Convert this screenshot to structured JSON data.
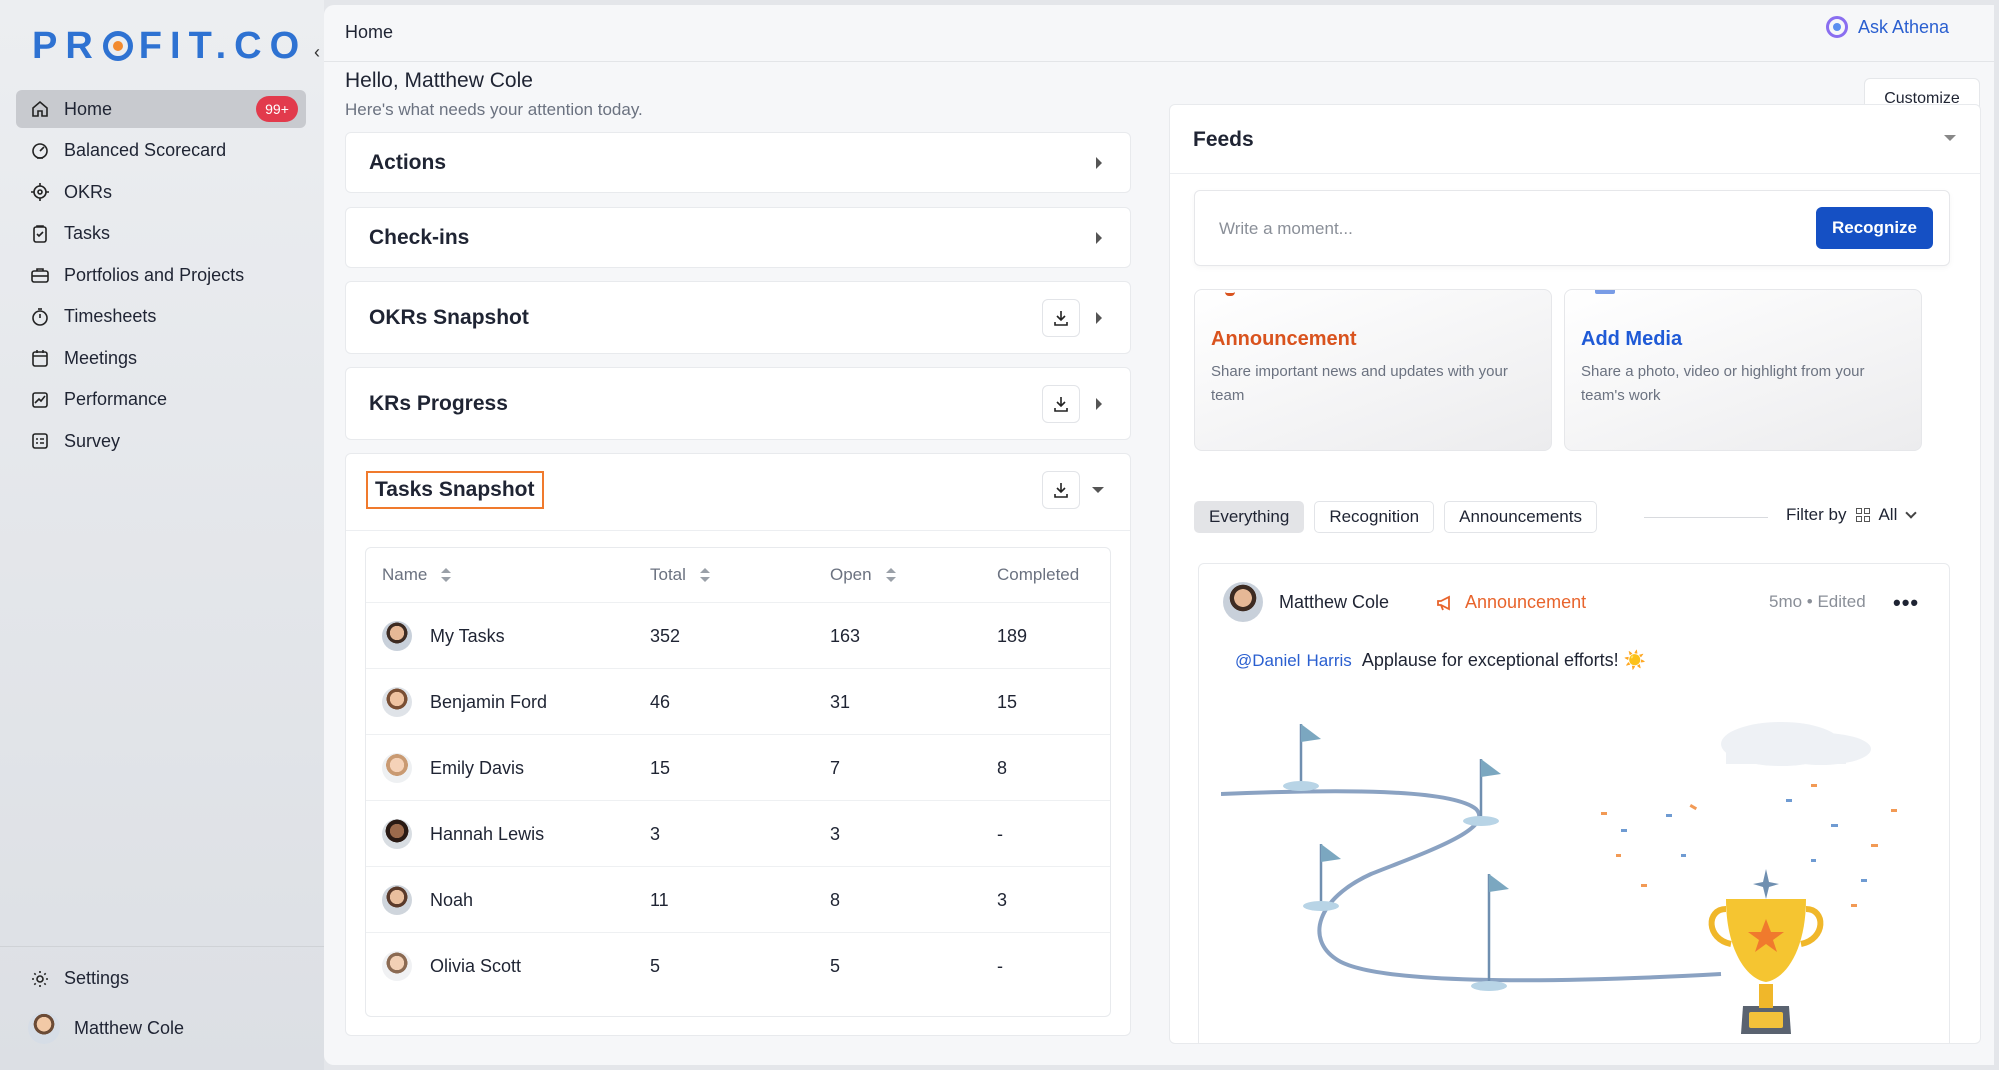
{
  "brand": {
    "logo_left": "PR",
    "logo_right": "FIT.CO"
  },
  "sidebar": {
    "items": [
      {
        "label": "Home",
        "icon": "home-icon",
        "badge": "99+"
      },
      {
        "label": "Balanced Scorecard",
        "icon": "scorecard-icon"
      },
      {
        "label": "OKRs",
        "icon": "target-icon"
      },
      {
        "label": "Tasks",
        "icon": "clipboard-icon"
      },
      {
        "label": "Portfolios and Projects",
        "icon": "briefcase-icon"
      },
      {
        "label": "Timesheets",
        "icon": "stopwatch-icon"
      },
      {
        "label": "Meetings",
        "icon": "calendar-icon"
      },
      {
        "label": "Performance",
        "icon": "chart-icon"
      },
      {
        "label": "Survey",
        "icon": "checklist-icon"
      }
    ],
    "settings_label": "Settings",
    "user_name": "Matthew Cole"
  },
  "header": {
    "breadcrumb": "Home",
    "ask_label": "Ask Athena"
  },
  "greeting": {
    "title": "Hello, Matthew Cole",
    "subtitle": "Here's what needs your attention today.",
    "customize_label": "Customize"
  },
  "sections": {
    "actions": "Actions",
    "checkins": "Check-ins",
    "okrs_snapshot": "OKRs Snapshot",
    "krs_progress": "KRs Progress",
    "tasks_snapshot": "Tasks Snapshot"
  },
  "tasks_table": {
    "columns": [
      "Name",
      "Total",
      "Open",
      "Completed"
    ],
    "rows": [
      {
        "name": "My Tasks",
        "total": "352",
        "open": "163",
        "completed": "189"
      },
      {
        "name": "Benjamin Ford",
        "total": "46",
        "open": "31",
        "completed": "15"
      },
      {
        "name": "Emily Davis",
        "total": "15",
        "open": "7",
        "completed": "8"
      },
      {
        "name": "Hannah Lewis",
        "total": "3",
        "open": "3",
        "completed": "-"
      },
      {
        "name": "Noah",
        "total": "11",
        "open": "8",
        "completed": "3"
      },
      {
        "name": "Olivia Scott",
        "total": "5",
        "open": "5",
        "completed": "-"
      }
    ]
  },
  "feeds": {
    "title": "Feeds",
    "compose_placeholder": "Write a moment...",
    "recognize_label": "Recognize",
    "cards": [
      {
        "title": "Announcement",
        "desc": "Share important news and updates with your team",
        "color": "#d9531e"
      },
      {
        "title": "Add Media",
        "desc": "Share a photo, video or highlight from your team's work",
        "color": "#1f5ad6"
      }
    ],
    "tabs": [
      "Everything",
      "Recognition",
      "Announcements"
    ],
    "filter_label": "Filter by",
    "filter_value": "All",
    "post": {
      "author": "Matthew Cole",
      "type": "Announcement",
      "time": "5mo • Edited",
      "mention_first": "@Daniel",
      "mention_last": "Harris",
      "text": "Applause for exceptional efforts! ☀️"
    }
  },
  "colors": {
    "accent": "#1550c4",
    "badge": "#e23a4c",
    "highlight": "#f07a2d",
    "announcement": "#e8642c"
  }
}
